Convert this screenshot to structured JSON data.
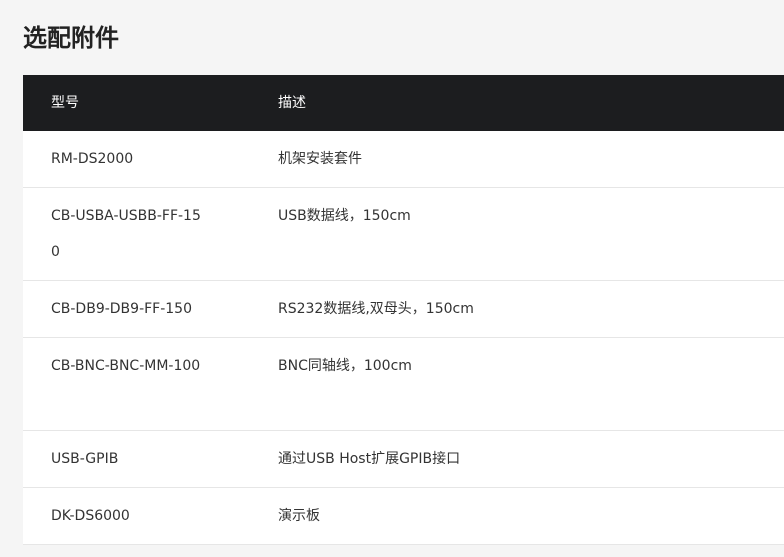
{
  "section_title": "选配附件",
  "table": {
    "headers": {
      "model": "型号",
      "description": "描述"
    },
    "rows": [
      {
        "model": "RM-DS2000",
        "description": "机架安装套件"
      },
      {
        "model": "CB-USBA-USBB-FF-150",
        "description": "USB数据线，150cm"
      },
      {
        "model": "CB-DB9-DB9-FF-150",
        "description": "RS232数据线,双母头，150cm"
      },
      {
        "model": "CB-BNC-BNC-MM-100",
        "description": "BNC同轴线，100cm"
      },
      {
        "model": "USB-GPIB",
        "description": "通过USB Host扩展GPIB接口"
      },
      {
        "model": "DK-DS6000",
        "description": "演示板"
      }
    ]
  }
}
